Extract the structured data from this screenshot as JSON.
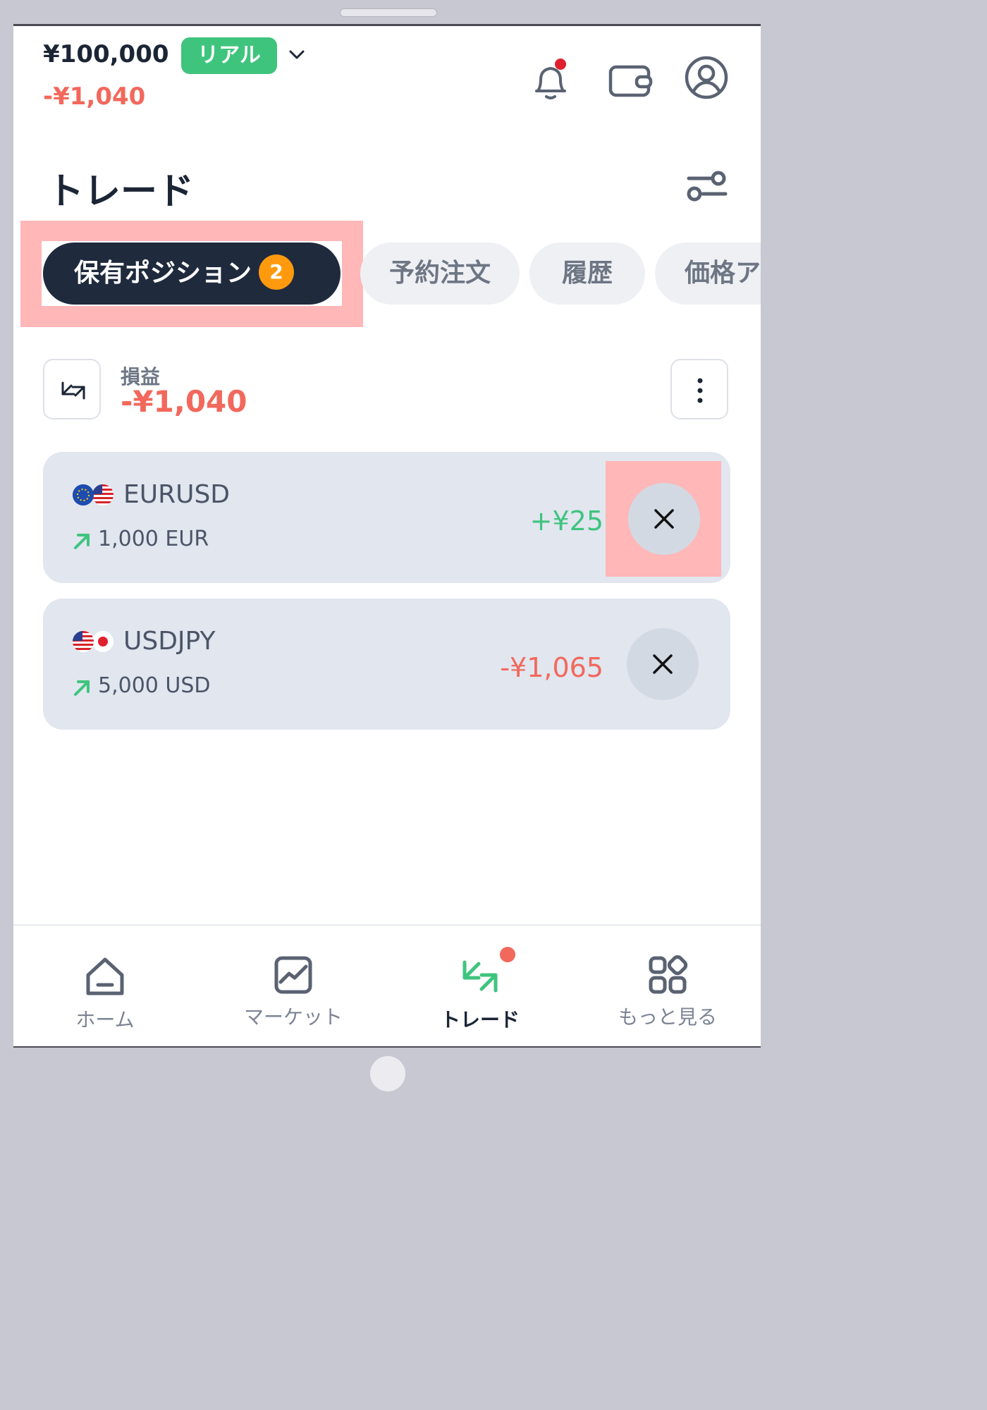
{
  "header": {
    "balance": "¥100,000",
    "account_type": "リアル",
    "pnl": "-¥1,040",
    "icons": [
      "bell-icon",
      "wallet-icon",
      "user-icon"
    ]
  },
  "page": {
    "title": "トレード",
    "settings_icon": "sliders-icon"
  },
  "tabs": [
    {
      "label": "保有ポジション",
      "badge": "2",
      "active": true
    },
    {
      "label": "予約注文",
      "active": false
    },
    {
      "label": "履歴",
      "active": false
    },
    {
      "label": "価格ア",
      "active": false
    }
  ],
  "summary": {
    "label": "損益",
    "value": "-¥1,040",
    "icons": [
      "swap-arrows-icon",
      "more-vertical-icon"
    ]
  },
  "positions": [
    {
      "symbol": "EURUSD",
      "quantity": "1,000 EUR",
      "pnl": "+¥25",
      "direction": "buy"
    },
    {
      "symbol": "USDJPY",
      "quantity": "5,000 USD",
      "pnl": "-¥1,065",
      "direction": "buy"
    }
  ],
  "bottom_nav": [
    {
      "label": "ホーム",
      "icon": "home-icon",
      "active": false
    },
    {
      "label": "マーケット",
      "icon": "chart-icon",
      "active": false
    },
    {
      "label": "トレード",
      "icon": "trade-arrows-icon",
      "active": true
    },
    {
      "label": "もっと見る",
      "icon": "grid-icon",
      "active": false
    }
  ],
  "colors": {
    "accent_green": "#3fc47e",
    "loss_red": "#f2685c",
    "dark_navy": "#1f2a3d",
    "badge_orange": "#ff9a0e",
    "highlight_pink": "#ffb7b8"
  }
}
